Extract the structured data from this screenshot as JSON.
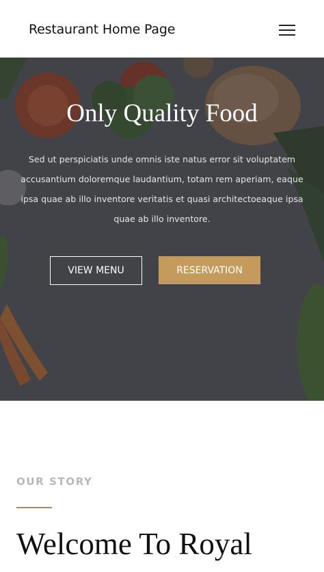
{
  "header": {
    "site_title": "Restaurant Home Page",
    "menu_icon": "hamburger-menu-icon"
  },
  "hero": {
    "title": "Only Quality Food",
    "text": "Sed ut perspiciatis unde omnis iste natus error sit voluptatem accusantium doloremque laudantium, totam rem aperiam, eaque ipsa quae ab illo inventore veritatis et quasi architectoeaque ipsa quae ab illo inventore.",
    "buttons": {
      "view_menu": "VIEW MENU",
      "reservation": "RESERVATION"
    }
  },
  "story": {
    "label": "OUR STORY",
    "heading": "Welcome To Royal"
  },
  "colors": {
    "accent": "#c49a5d",
    "hero_overlay": "#2d2d34",
    "label_gray": "#b8b8b8"
  }
}
